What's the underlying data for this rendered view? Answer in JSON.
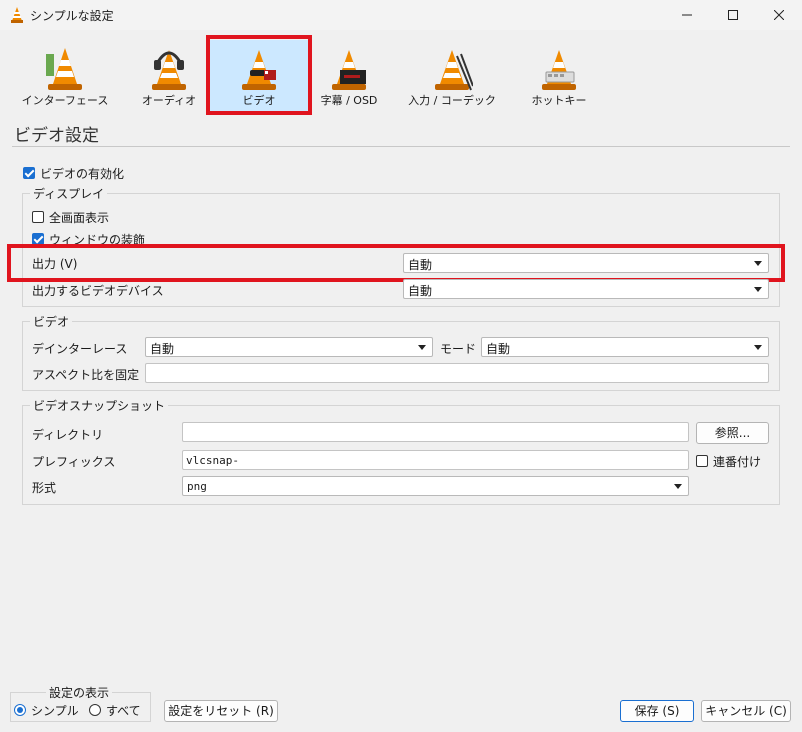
{
  "window": {
    "title": "シンプルな設定",
    "controls": [
      "minimize",
      "maximize",
      "close"
    ]
  },
  "categories": [
    {
      "label": "インターフェース",
      "icon": "interface-cone-icon",
      "selected": false
    },
    {
      "label": "オーディオ",
      "icon": "audio-headphones-cone-icon",
      "selected": false
    },
    {
      "label": "ビデオ",
      "icon": "video-cone-icon",
      "selected": true
    },
    {
      "label": "字幕 / OSD",
      "icon": "subtitle-osd-icon",
      "selected": false
    },
    {
      "label": "入力 / コーデック",
      "icon": "input-codec-icon",
      "selected": false
    },
    {
      "label": "ホットキー",
      "icon": "hotkeys-icon",
      "selected": false
    }
  ],
  "page_title": "ビデオ設定",
  "enable_video": {
    "label": "ビデオの有効化",
    "checked": true
  },
  "display": {
    "title": "ディスプレイ",
    "fullscreen": {
      "label": "全画面表示",
      "checked": false
    },
    "decorations": {
      "label": "ウィンドウの装飾",
      "checked": true
    },
    "output": {
      "label": "出力 (V)",
      "value": "自動"
    },
    "device": {
      "label": "出力するビデオデバイス",
      "value": "自動"
    }
  },
  "video": {
    "title": "ビデオ",
    "deinterlace": {
      "label": "デインターレース",
      "value": "自動"
    },
    "mode": {
      "label": "モード",
      "value": "自動"
    },
    "aspect": {
      "label": "アスペクト比を固定",
      "value": ""
    }
  },
  "snapshot": {
    "title": "ビデオスナップショット",
    "directory": {
      "label": "ディレクトリ",
      "value": ""
    },
    "browse_label": "参照...",
    "prefix": {
      "label": "プレフィックス",
      "value": "vlcsnap-"
    },
    "sequential": {
      "label": "連番付け",
      "checked": false
    },
    "format": {
      "label": "形式",
      "value": "png"
    }
  },
  "footer": {
    "show_settings": "設定の表示",
    "simple": "シンプル",
    "all": "すべて",
    "reset": "設定をリセット (R)",
    "save": "保存 (S)",
    "cancel": "キャンセル (C)"
  },
  "colors": {
    "accent": "#1a6fd1",
    "highlight": "#e0141e",
    "selected_tab": "#cce8ff",
    "cone_orange": "#f08a00"
  }
}
